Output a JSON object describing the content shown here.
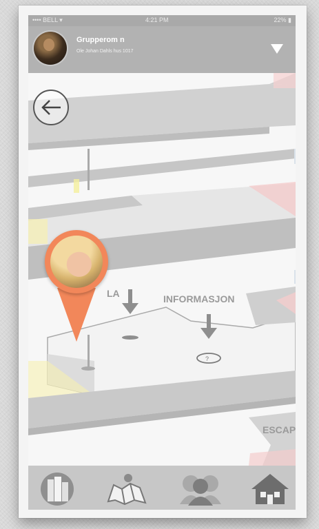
{
  "status_bar": {
    "carrier": "•••• BELL ▾",
    "time": "4:21 PM",
    "battery": "22% ▮"
  },
  "header": {
    "room_name": "Grupperom n",
    "subtitle": "Ole Johan Dahls hus 1017"
  },
  "map": {
    "labels": {
      "left": "LA",
      "info": "INFORMASJON",
      "escap": "ESCAP"
    }
  },
  "tabs": [
    {
      "icon": "building-icon"
    },
    {
      "icon": "map-icon"
    },
    {
      "icon": "people-icon"
    },
    {
      "icon": "home-icon"
    }
  ],
  "colors": {
    "pin": "#f2875a",
    "header": "#b2b2b2",
    "tabbar": "#c7c7c7"
  }
}
